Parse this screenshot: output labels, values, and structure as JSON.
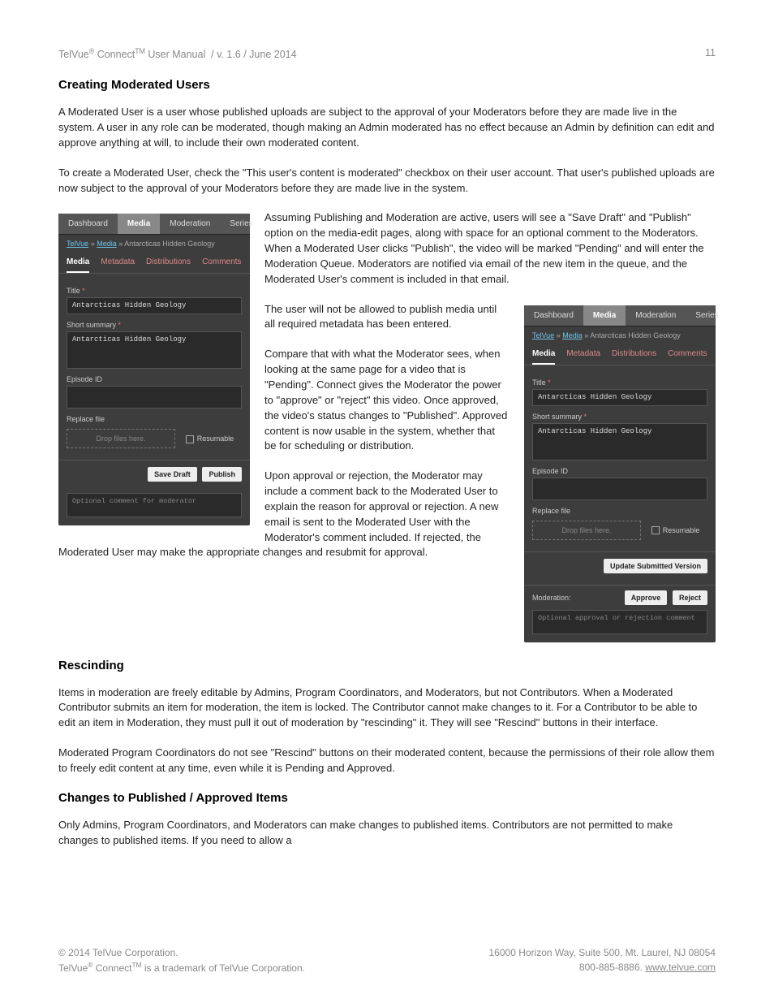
{
  "header": {
    "left": "TelVue® Connect™ User Manual  / v. 1.6 / June 2014",
    "page_number": "11"
  },
  "body": {
    "h1": "Creating Moderated Users",
    "p1": "A Moderated User is a user whose published uploads are subject to the approval of your Moderators before they are made live in the system.  A user in any role can be moderated, though making an Admin moderated has no effect because an Admin by definition can edit and approve anything at will, to include their own moderated content.",
    "p2": "To create a Moderated User, check the \"This user's content is moderated\" checkbox on their user account.  That user's published uploads are now subject to the approval of your Moderators before they are made live in the system.",
    "p3": "Assuming Publishing and Moderation are active, users will see a \"Save Draft\" and \"Publish\" option on the media-edit pages, along with space for an optional comment to the Moderators. When a Moderated User clicks \"Publish\", the video will be marked \"Pending\" and will enter the Moderation Queue. Moderators are notified via email of the new item in the queue, and the Moderated User's comment is included in that email.",
    "p4": "The user will not be allowed to publish media until all required metadata has been entered.",
    "p5": "Compare that with what the Moderator sees, when looking at the same page for a video that is \"Pending\".  Connect gives the Moderator the power to \"approve\" or \"reject\" this video.  Once approved, the video's status changes to \"Published\".  Approved content is now usable in the system, whether that be for scheduling or distribution.",
    "p6": "Upon approval or rejection, the Moderator may include a comment back to the Moderated User to explain the reason for approval or rejection. A new email is sent to the Moderated User with the Moderator's comment included.  If rejected, the Moderated User may make the appropriate changes and resubmit for approval.",
    "h2": "Rescinding",
    "p7": "Items in moderation are freely editable by Admins, Program Coordinators, and Moderators, but not Contributors. When a Moderated Contributor submits an item for moderation, the item is locked. The Contributor cannot make changes to it.  For a Contributor to be able to edit an item in Moderation, they must pull it out of moderation by \"rescinding\" it. They will see \"Rescind\" buttons in their interface.",
    "p8": "Moderated Program Coordinators do not see \"Rescind\" buttons on their moderated content, because the permissions of their role allow them to freely edit content at any time, even while it is Pending and Approved.",
    "h3": "Changes to Published / Approved Items",
    "p9": "Only Admins, Program Coordinators, and Moderators can make changes to published items.  Contributors are not permitted to make changes to published items.  If you need to allow a"
  },
  "mock_user": {
    "navtabs": [
      "Dashboard",
      "Media",
      "Moderation",
      "Series"
    ],
    "crumbs": {
      "a": "TelVue",
      "b": "Media",
      "c": "Antarcticas Hidden Geology"
    },
    "subtabs": [
      "Media",
      "Metadata",
      "Distributions",
      "Comments"
    ],
    "title_label": "Title",
    "title_value": "Antarcticas Hidden Geology",
    "summary_label": "Short summary",
    "summary_value": "Antarcticas Hidden Geology",
    "episode_label": "Episode ID",
    "replace_label": "Replace file",
    "dropzone": "Drop files here.",
    "resumable": "Resumable",
    "btn_savedraft": "Save Draft",
    "btn_publish": "Publish",
    "comment_placeholder": "Optional comment for moderator"
  },
  "mock_mod": {
    "navtabs": [
      "Dashboard",
      "Media",
      "Moderation",
      "Series"
    ],
    "crumbs": {
      "a": "TelVue",
      "b": "Media",
      "c": "Antarcticas Hidden Geology"
    },
    "subtabs": [
      "Media",
      "Metadata",
      "Distributions",
      "Comments"
    ],
    "title_label": "Title",
    "title_value": "Antarcticas Hidden Geology",
    "summary_label": "Short summary",
    "summary_value": "Antarcticas Hidden Geology",
    "episode_label": "Episode ID",
    "replace_label": "Replace file",
    "dropzone": "Drop files here.",
    "resumable": "Resumable",
    "btn_update": "Update Submitted Version",
    "mod_label": "Moderation:",
    "btn_approve": "Approve",
    "btn_reject": "Reject",
    "comment_placeholder": "Optional approval or rejection comment"
  },
  "footer": {
    "left1": "© 2014 TelVue Corporation.",
    "left2": "TelVue® Connect™ is a trademark of TelVue Corporation.",
    "right1": "16000 Horizon Way, Suite 500, Mt. Laurel, NJ 08054",
    "right2a": "800-885-8886.  ",
    "right2b": "www.telvue.com"
  }
}
